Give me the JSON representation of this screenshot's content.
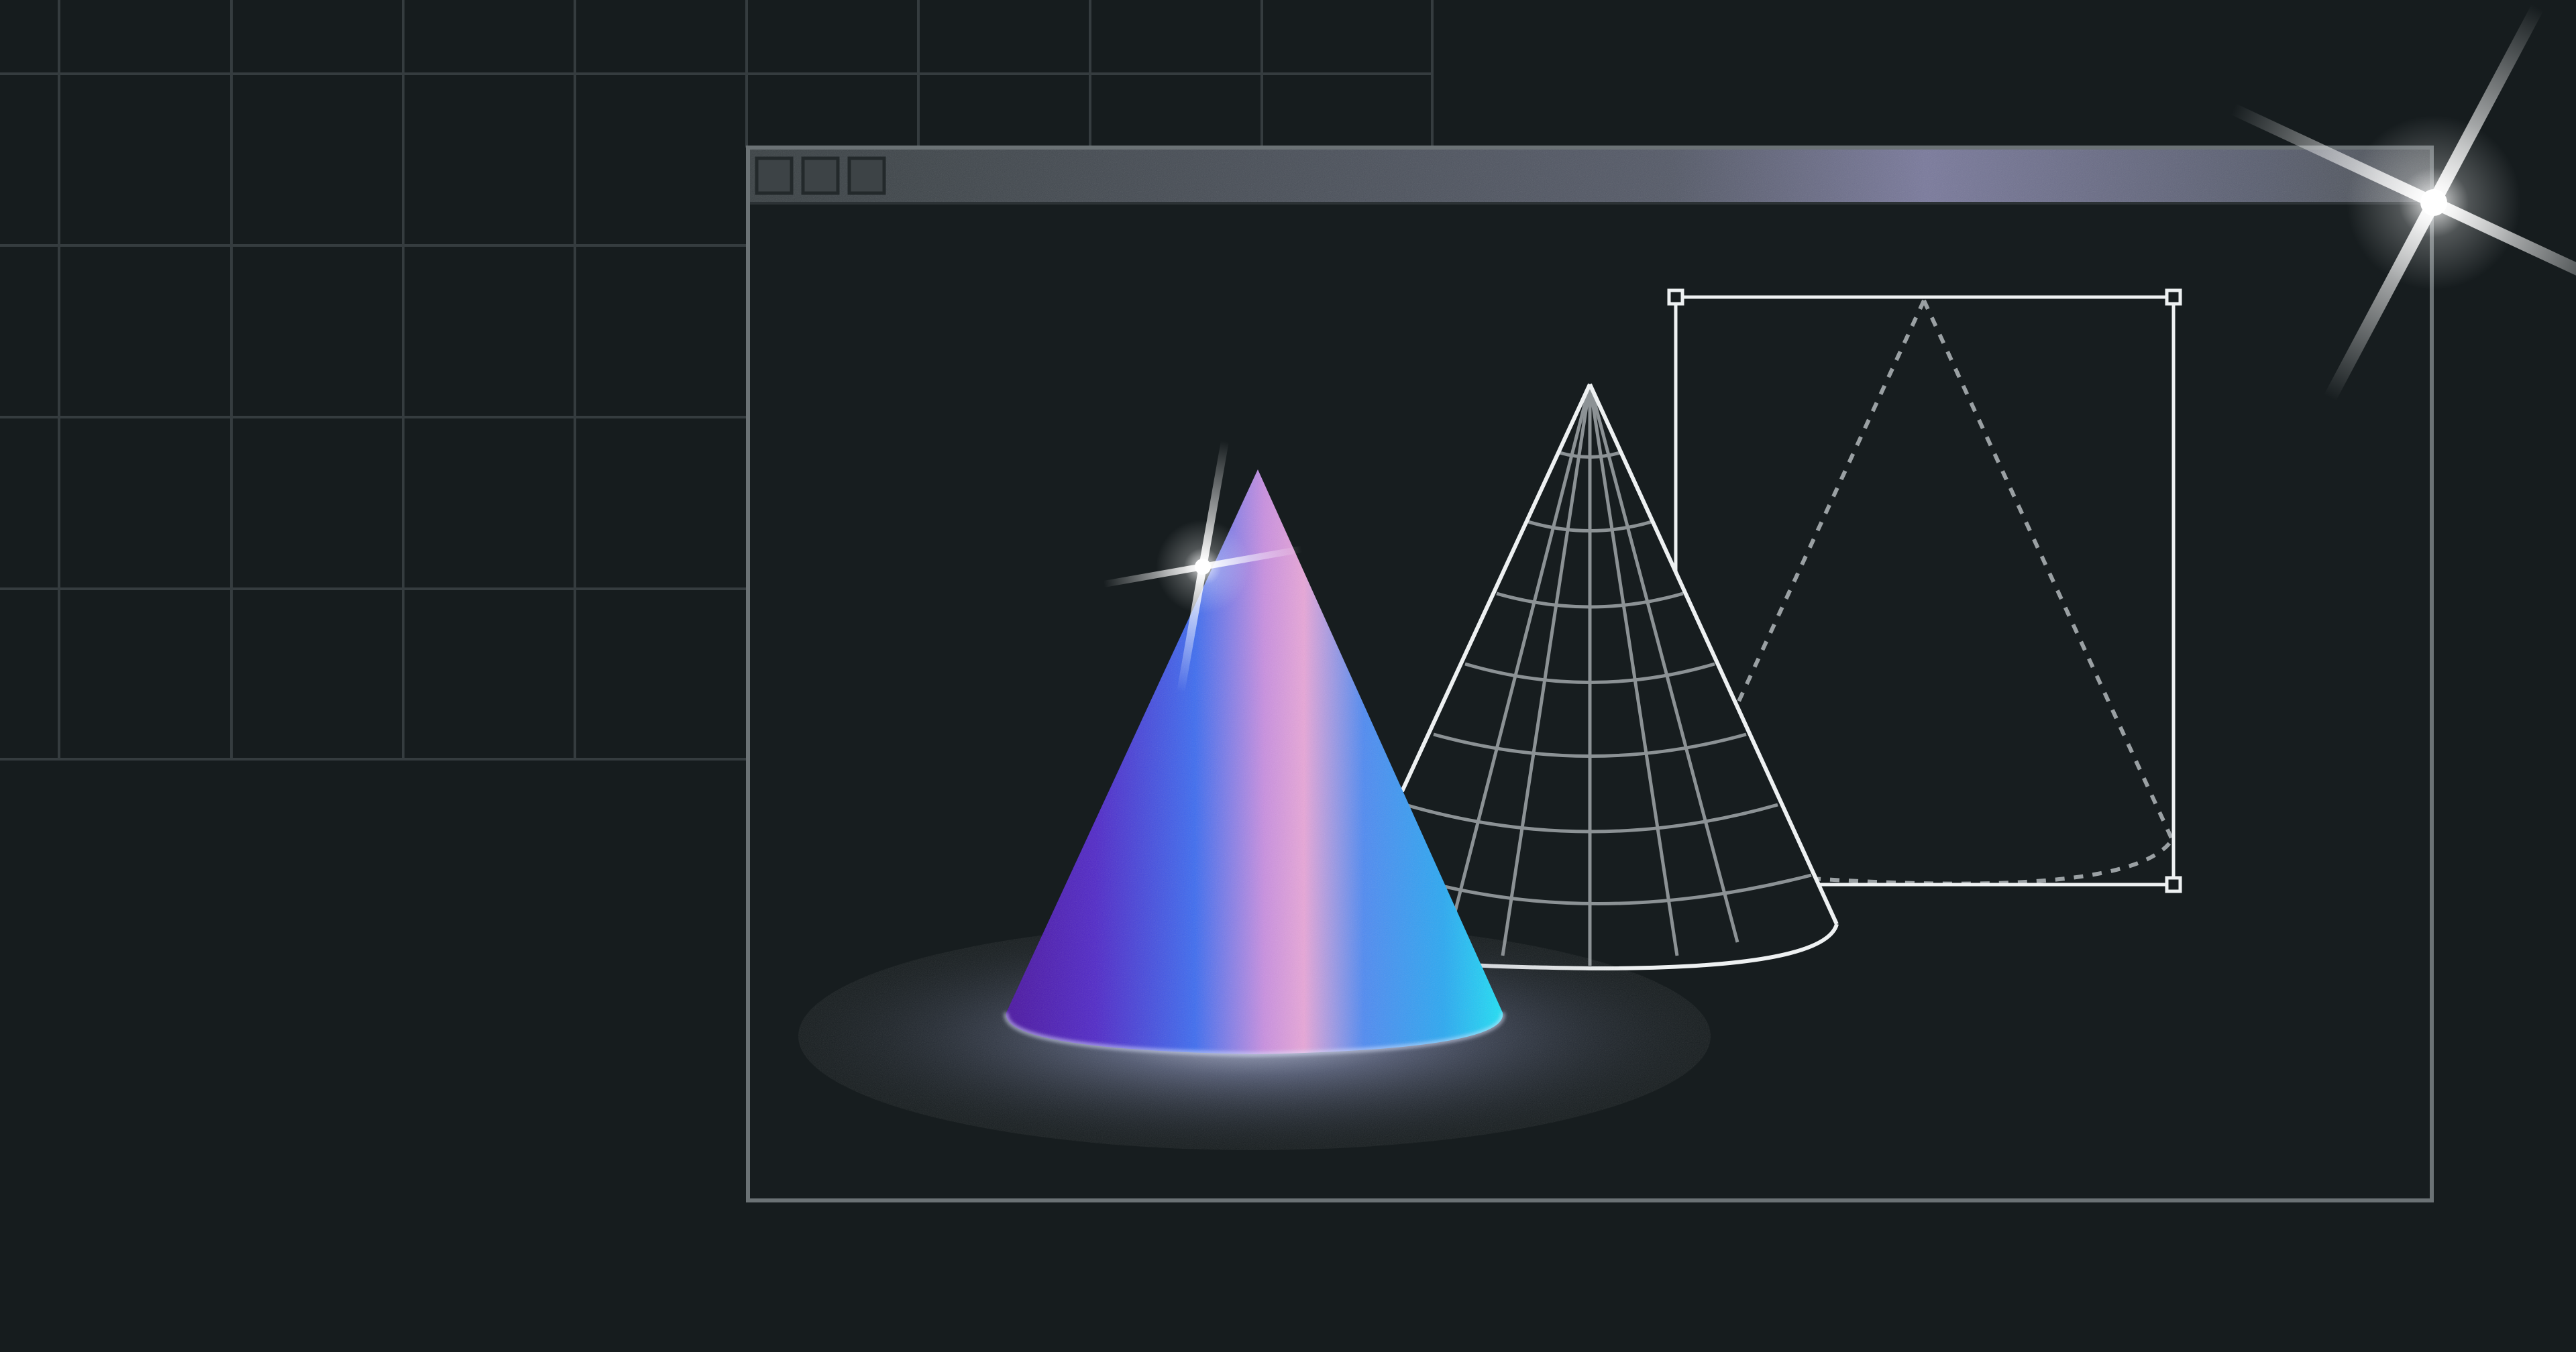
{
  "illustration": {
    "colors": {
      "background": "#161c1e",
      "grid_line": "#353c3f",
      "window_border": "#6b7275",
      "titlebar_tint": "#8f8fb8",
      "outline": "#e8ecef",
      "cone_purple": "#5a1fb0",
      "cone_blue": "#2f6df0",
      "cone_pink": "#e8a2d6",
      "cone_cyan": "#1ed6f2",
      "sparkle": "#ffffff"
    },
    "icons": {
      "window_controls": [
        "titlebar-button-icon",
        "titlebar-button-icon",
        "titlebar-button-icon"
      ],
      "sparkles": [
        "sparkle-icon",
        "sparkle-icon"
      ]
    }
  }
}
